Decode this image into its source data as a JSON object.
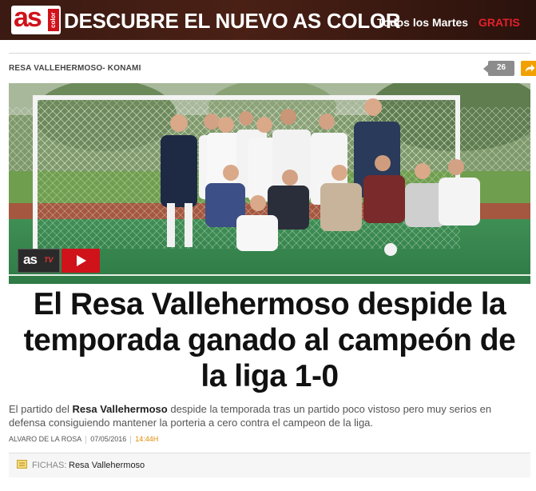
{
  "promo": {
    "logo_as": "as",
    "logo_color": "color",
    "title": "DESCUBRE EL NUEVO AS COLOR",
    "subtitle": "Todos los Martes",
    "free": "GRATIS"
  },
  "article": {
    "section": "RESA VALLEHERMOSO- KONAMI",
    "comment_count": "26",
    "headline": "El Resa Vallehermoso despide la temporada ganado al campeón de la liga 1-0",
    "lead_prefix": "El partido del ",
    "lead_bold": "Resa Vallehermoso",
    "lead_suffix": " despide la temporada tras un partido poco vistoso pero muy serios en defensa consiguiendo mantener la porteria a cero contra el campeon de la liga.",
    "author": "ALVARO DE LA ROSA",
    "date": "07/05/2016",
    "time": "14:44h",
    "fichas_label": "FICHAS:",
    "fichas_link": "Resa Vallehermoso"
  },
  "video_badge": {
    "as": "as",
    "tv": "TV"
  },
  "colors": {
    "brand_red": "#d0121b",
    "share_orange": "#f2a000",
    "time_orange": "#e08a00"
  },
  "icons": [
    "comment-icon",
    "share-icon",
    "play-icon",
    "document-icon"
  ]
}
